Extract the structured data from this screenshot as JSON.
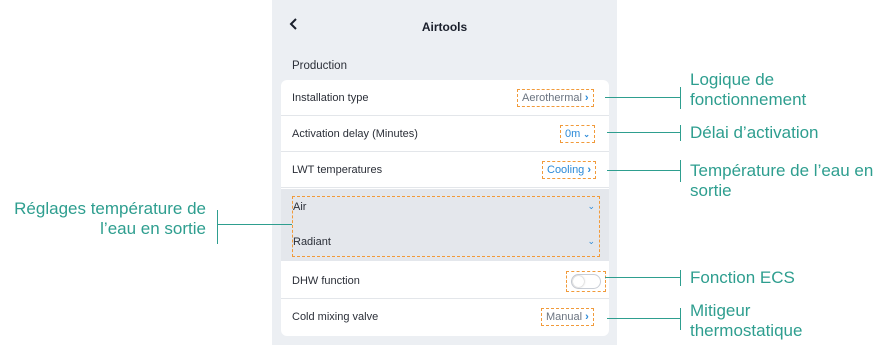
{
  "header": {
    "back_icon": "chevron-left-icon",
    "title": "Airtools"
  },
  "section_title": "Production",
  "rows": {
    "installation_type": {
      "label": "Installation type",
      "value": "Aerothermal"
    },
    "activation_delay": {
      "label": "Activation delay (Minutes)",
      "value": "0m"
    },
    "lwt_temperatures": {
      "label": "LWT temperatures",
      "value": "Cooling"
    },
    "sub_air": {
      "label": "Air"
    },
    "sub_radiant": {
      "label": "Radiant"
    },
    "dhw_function": {
      "label": "DHW function",
      "toggle_on": false
    },
    "cold_mixing_valve": {
      "label": "Cold mixing valve",
      "value": "Manual"
    }
  },
  "annotations": {
    "logique": "Logique de fonctionnement",
    "delai": "Délai d’activation",
    "temperature": "Température de l’eau en sortie",
    "reglages": "Réglages température de l’eau en sortie",
    "ecs": "Fonction ECS",
    "mitigeur": "Mitigeur thermostatique"
  },
  "colors": {
    "accent": "#2b8ad8",
    "annotation": "#2e9e8f",
    "highlight": "#f19a3a"
  }
}
